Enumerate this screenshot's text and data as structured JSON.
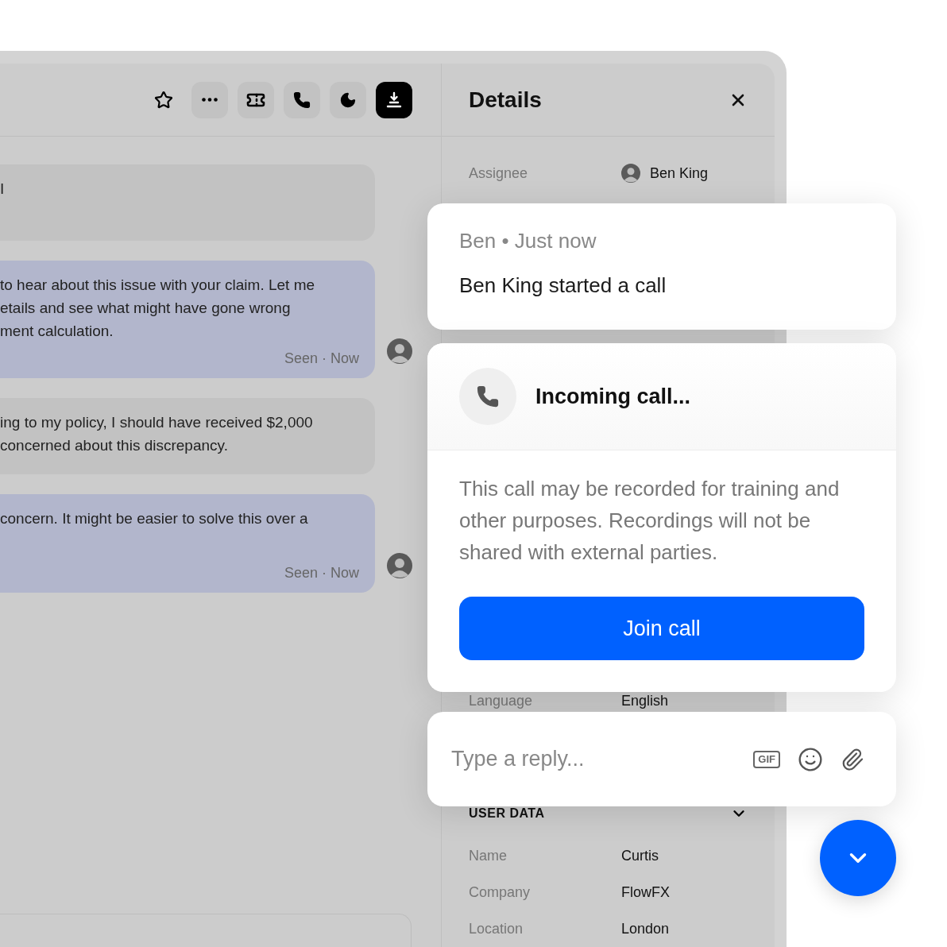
{
  "toolbar": {
    "buttons": [
      {
        "kind": "star",
        "active": false
      },
      {
        "kind": "more",
        "active": false
      },
      {
        "kind": "ticket",
        "active": false
      },
      {
        "kind": "phone",
        "active": false
      },
      {
        "kind": "snooze",
        "active": false
      },
      {
        "kind": "inbox",
        "active": true
      }
    ]
  },
  "messages": [
    {
      "kind": "received",
      "lines": [
        "I"
      ]
    },
    {
      "kind": "sent",
      "lines": [
        "to hear about this issue with your claim. Let me",
        "etails and see what might have gone wrong",
        "ment calculation."
      ],
      "status": "Seen · Now"
    },
    {
      "kind": "received",
      "lines": [
        "ing to my policy, I should have received $2,000",
        "concerned about this discrepancy."
      ]
    },
    {
      "kind": "sent",
      "lines": [
        "concern. It might be easier to solve this over a"
      ],
      "status": "Seen · Now"
    }
  ],
  "details": {
    "title": "Details",
    "rows": [
      {
        "label": "Assignee",
        "value": "Ben King",
        "avatar": true
      },
      {
        "label": "Language",
        "value": "English",
        "avatar": false
      }
    ],
    "section": {
      "title": "USER DATA",
      "expanded": true,
      "rows": [
        {
          "label": "Name",
          "value": "Curtis"
        },
        {
          "label": "Company",
          "value": "FlowFX"
        },
        {
          "label": "Location",
          "value": "London"
        }
      ]
    }
  },
  "notification": {
    "meta": "Ben • Just now",
    "text": "Ben King started a call"
  },
  "call": {
    "title": "Incoming call...",
    "notice": "This call may be recorded for training and other purposes. Recordings will not be shared with external parties.",
    "button": "Join call"
  },
  "composer": {
    "placeholder": "Type a reply...",
    "gif_label": "GIF"
  }
}
